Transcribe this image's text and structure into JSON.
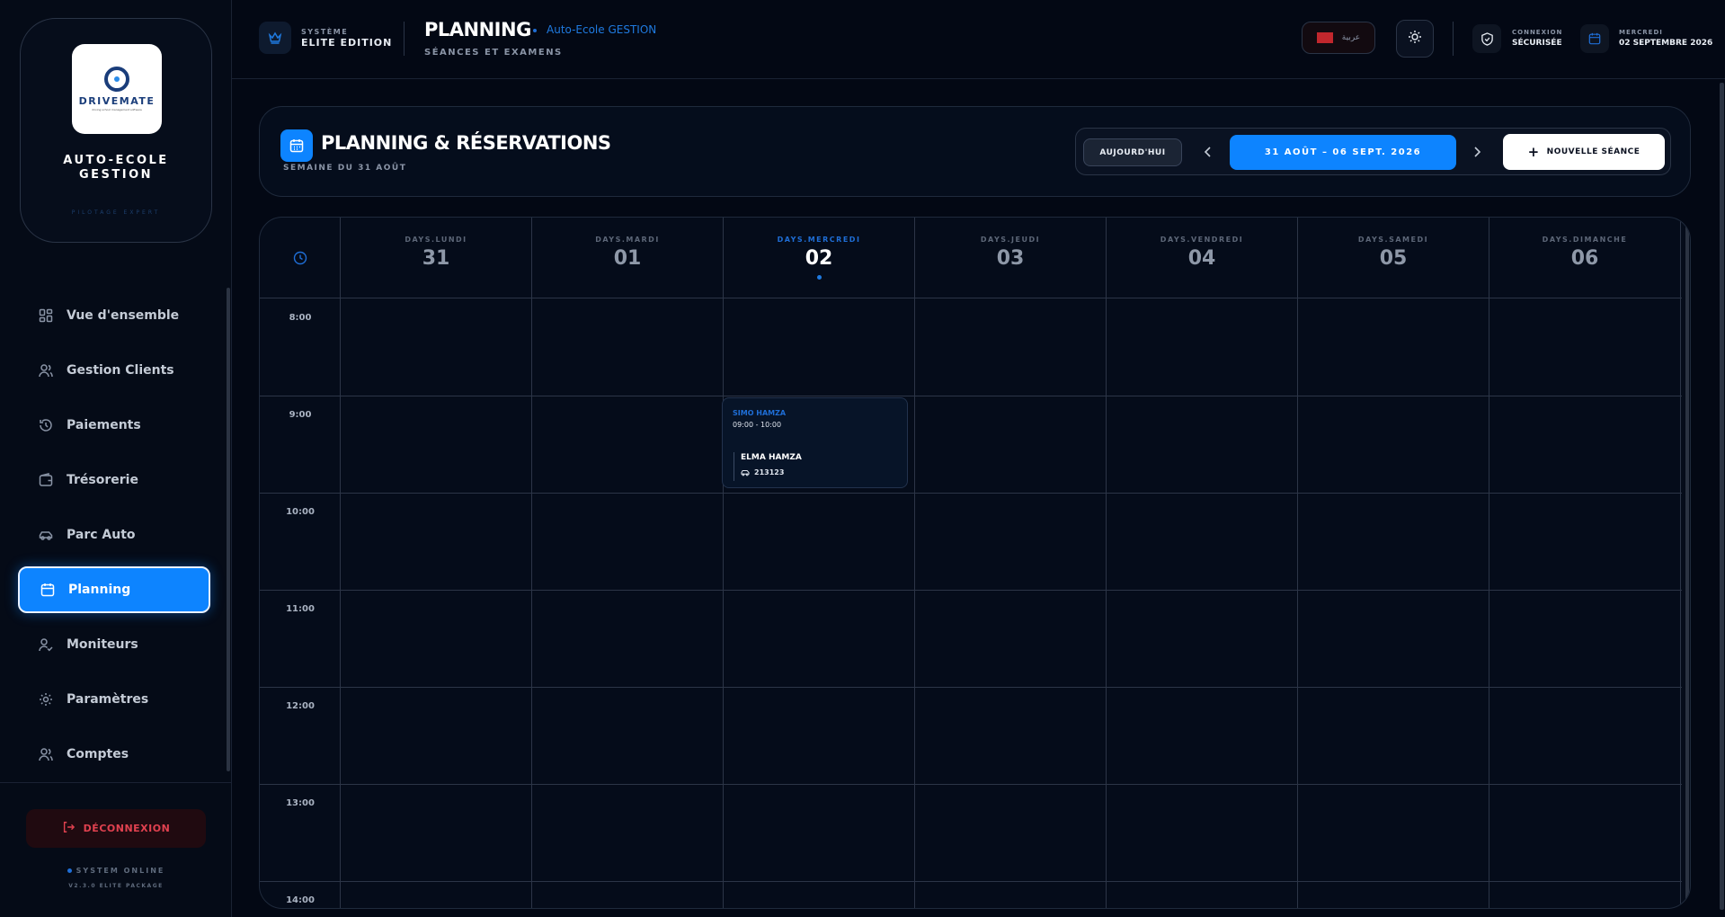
{
  "brand": {
    "logo_text": "DRIVEMATE",
    "logo_sub": "driving school management software",
    "name_line1": "AUTO-ECOLE",
    "name_line2": "GESTION",
    "tagline": "PILOTAGE EXPERT"
  },
  "sidebar": {
    "items": [
      {
        "label": "Vue d'ensemble",
        "icon": "grid-icon"
      },
      {
        "label": "Gestion Clients",
        "icon": "users-icon"
      },
      {
        "label": "Paiements",
        "icon": "history-icon"
      },
      {
        "label": "Trésorerie",
        "icon": "wallet-icon"
      },
      {
        "label": "Parc Auto",
        "icon": "car-icon"
      },
      {
        "label": "Planning",
        "icon": "calendar-icon",
        "active": true
      },
      {
        "label": "Moniteurs",
        "icon": "user-check-icon"
      },
      {
        "label": "Paramètres",
        "icon": "gear-icon"
      },
      {
        "label": "Comptes",
        "icon": "users-icon"
      }
    ],
    "logout_label": "DÉCONNEXION",
    "status_text": "SYSTEM ONLINE",
    "version_text": "V2.3.0 ELITE PACKAGE"
  },
  "header": {
    "system_label": "SYSTÈME",
    "system_value": "ELITE EDITION",
    "page_title": "PLANNING",
    "org_name": "Auto-Ecole GESTION",
    "page_subtitle": "SÉANCES ET EXAMENS",
    "language_label": "عربية",
    "connection_label": "CONNEXION",
    "connection_value": "SÉCURISÉE",
    "date_label": "MERCREDI",
    "date_value": "02 SEPTEMBRE 2026"
  },
  "planning": {
    "title": "PLANNING & RÉSERVATIONS",
    "subtitle": "SEMAINE DU 31 AOÛT",
    "today_label": "AUJOURD'HUI",
    "range_label": "31 AOÛT – 06 SEPT. 2026",
    "new_session_label": "NOUVELLE SÉANCE"
  },
  "calendar": {
    "days": [
      {
        "name": "DAYS.LUNDI",
        "num": "31"
      },
      {
        "name": "DAYS.MARDI",
        "num": "01"
      },
      {
        "name": "DAYS.MERCREDI",
        "num": "02",
        "today": true
      },
      {
        "name": "DAYS.JEUDI",
        "num": "03"
      },
      {
        "name": "DAYS.VENDREDI",
        "num": "04"
      },
      {
        "name": "DAYS.SAMEDI",
        "num": "05"
      },
      {
        "name": "DAYS.DIMANCHE",
        "num": "06"
      }
    ],
    "hours": [
      "8:00",
      "9:00",
      "10:00",
      "11:00",
      "12:00",
      "13:00",
      "14:00"
    ],
    "events": [
      {
        "instructor": "SIMO HAMZA",
        "time": "09:00 - 10:00",
        "student": "ELMA HAMZA",
        "vehicle": "213123",
        "day": "DAYS.MERCREDI",
        "hour": "9:00"
      }
    ]
  },
  "colors": {
    "accent": "#0d84ff",
    "background": "#030814",
    "danger": "#e0414f"
  }
}
